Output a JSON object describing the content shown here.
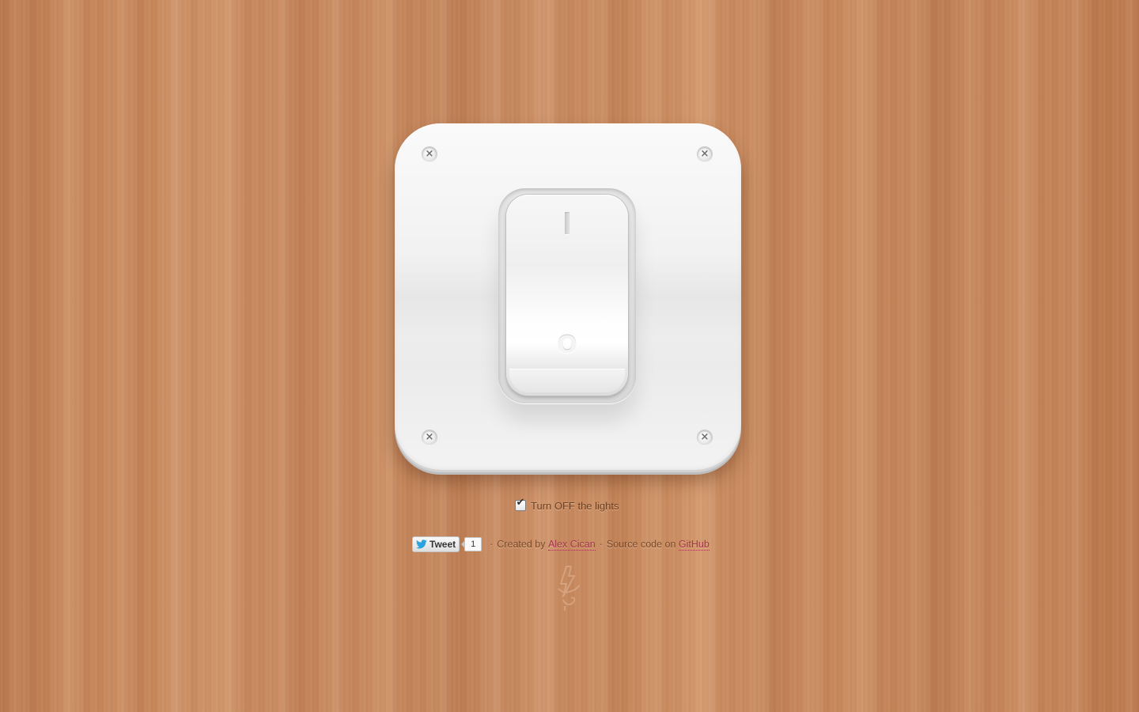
{
  "switch": {
    "on_mark": "I",
    "off_mark": "O",
    "state": "on"
  },
  "toggle": {
    "checked": true,
    "label": "Turn OFF the lights"
  },
  "credits": {
    "tweet_label": "Tweet",
    "tweet_count": "1",
    "separator": "·",
    "created_by_text": "Created by",
    "author_link": "Alex Cican",
    "source_text": "Source code on",
    "source_link": "GitHub"
  },
  "icons": {
    "screws": [
      "screw-icon",
      "screw-icon",
      "screw-icon",
      "screw-icon"
    ],
    "tweet_icon": "twitter-bird-icon",
    "logo": "lightning-logo-icon"
  },
  "colors": {
    "wood": "#c9865a",
    "plate": "#f4f4f4",
    "link": "#a3334b",
    "text": "#6b3f22"
  }
}
